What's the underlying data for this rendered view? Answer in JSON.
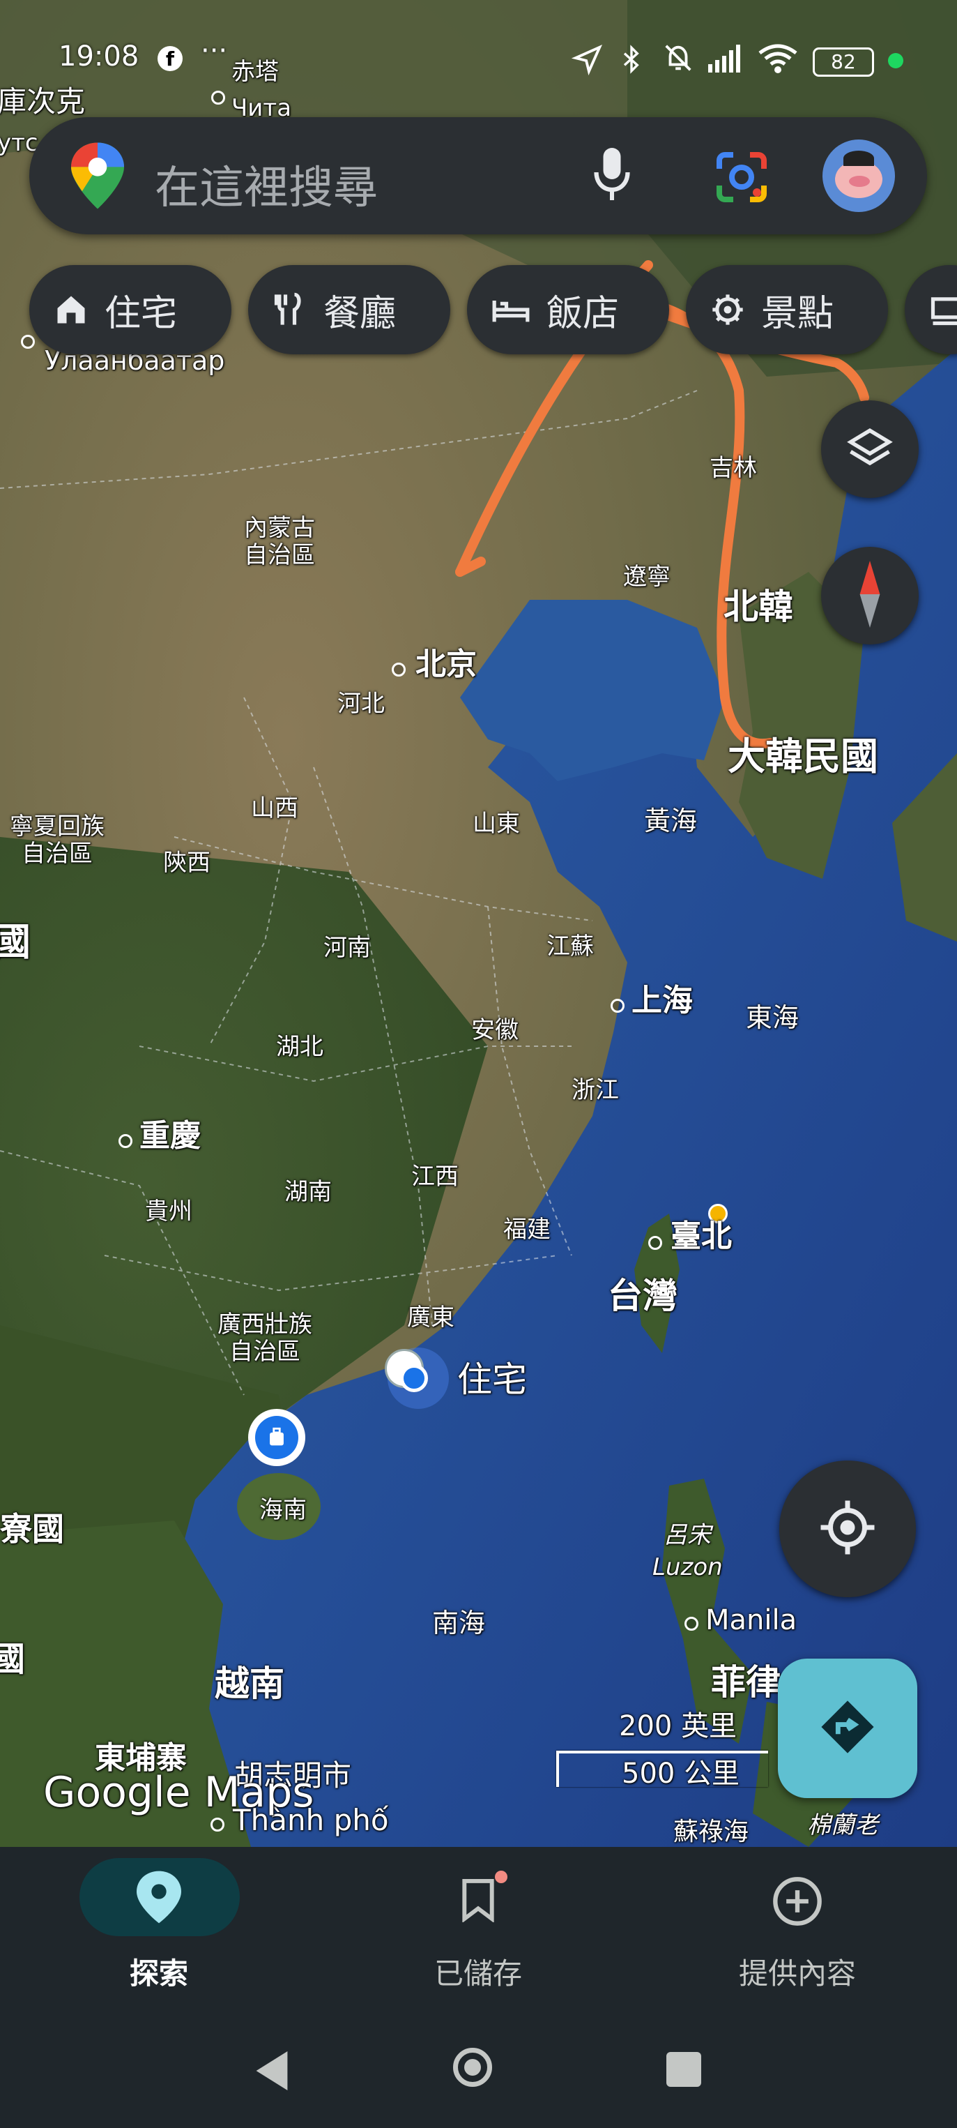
{
  "status_bar": {
    "time": "19:08",
    "battery": "82"
  },
  "search": {
    "placeholder": "在這裡搜尋"
  },
  "chips": [
    {
      "label": "住宅",
      "icon": "home-icon"
    },
    {
      "label": "餐廳",
      "icon": "restaurant-icon"
    },
    {
      "label": "飯店",
      "icon": "hotel-icon"
    },
    {
      "label": "景點",
      "icon": "attractions-icon"
    }
  ],
  "map": {
    "labels": {
      "chita_zh": "赤塔",
      "chita_ru": "Чита",
      "top_left_partial": "庫次克",
      "top_left_ru_partial": "утс",
      "ulaanbaatar": "Улаанбаатар",
      "jilin": "吉林",
      "inner_mongolia": "內蒙古\n自治區",
      "liaoning": "遼寧",
      "north_korea": "北韓",
      "beijing": "北京",
      "hebei": "河北",
      "south_korea": "大韓民國",
      "ningxia": "寧夏回族\n自治區",
      "shanxi": "山西",
      "shandong": "山東",
      "yellow_sea": "黃海",
      "shaanxi": "陝西",
      "china_partial": "國",
      "henan": "河南",
      "jiangsu": "江蘇",
      "shanghai": "上海",
      "east_sea": "東海",
      "anhui": "安徽",
      "hubei": "湖北",
      "zhejiang": "浙江",
      "chongqing": "重慶",
      "hunan": "湖南",
      "jiangxi": "江西",
      "guizhou": "貴州",
      "fujian": "福建",
      "taipei": "臺北",
      "taiwan": "台灣",
      "guangxi": "廣西壯族\n自治區",
      "guangdong": "廣東",
      "home": "住宅",
      "laos_partial": "寮國",
      "hainan": "海南",
      "luzon_zh": "呂宋",
      "luzon": "Luzon",
      "south_sea": "南海",
      "manila": "Manila",
      "vietnam": "越南",
      "philippines_partial": "菲律",
      "myanmar_partial": "國",
      "cambodia": "東埔寨",
      "hcmc_zh": "胡志明市",
      "hcmc_vi": "Thành phố",
      "sulu_sea": "蘇祿海",
      "mindanao_partial": "棉蘭老"
    },
    "watermark": "Google Maps",
    "scale": {
      "imperial": "200 英里",
      "metric": "500 公里"
    }
  },
  "bottom_nav": [
    {
      "label": "探索",
      "icon": "location-pin-icon",
      "active": true
    },
    {
      "label": "已儲存",
      "icon": "bookmark-icon",
      "active": false
    },
    {
      "label": "提供內容",
      "icon": "add-circle-icon",
      "active": false
    }
  ]
}
